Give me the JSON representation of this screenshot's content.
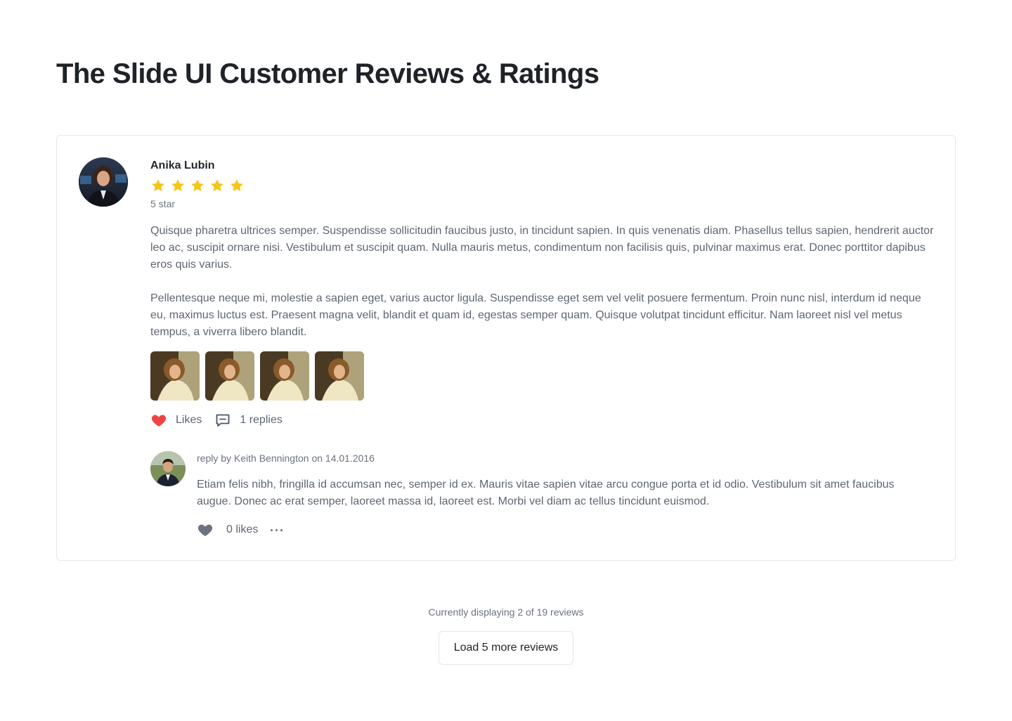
{
  "page": {
    "title": "The Slide UI Customer Reviews & Ratings"
  },
  "review": {
    "author": "Anika Lubin",
    "rating": 5,
    "rating_label": "5 star",
    "paragraphs": [
      "Quisque pharetra ultrices semper. Suspendisse sollicitudin faucibus justo, in tincidunt sapien. In quis venenatis diam. Phasellus tellus sapien, hendrerit auctor leo ac, suscipit ornare nisi. Vestibulum et suscipit quam. Nulla mauris metus, condimentum non facilisis quis, pulvinar maximus erat. Donec porttitor dapibus eros quis varius.",
      "Pellentesque neque mi, molestie a sapien eget, varius auctor ligula. Suspendisse eget sem vel velit posuere fermentum. Proin nunc nisl, interdum id neque eu, maximus luctus est. Praesent magna velit, blandit et quam id, egestas semper quam. Quisque volutpat tincidunt efficitur. Nam laoreet nisl vel metus tempus, a viverra libero blandit."
    ],
    "likes_label": "Likes",
    "replies_label": "1 replies",
    "icons": {
      "like": "heart-icon",
      "replies": "comment-icon",
      "star": "star-icon"
    },
    "colors": {
      "star": "#f5c518",
      "heart": "#ef4444"
    }
  },
  "reply": {
    "meta": "reply by Keith Bennington on 14.01.2016",
    "body": "Etiam felis nibh, fringilla id accumsan nec, semper id ex. Mauris vitae sapien vitae arcu congue porta et id odio. Vestibulum sit amet faucibus augue. Donec ac erat semper, laoreet massa id, laoreet est. Morbi vel diam ac tellus tincidunt euismod.",
    "likes_label": "0 likes"
  },
  "footer": {
    "status": "Currently displaying 2 of 19 reviews",
    "load_more_label": "Load 5 more reviews"
  }
}
